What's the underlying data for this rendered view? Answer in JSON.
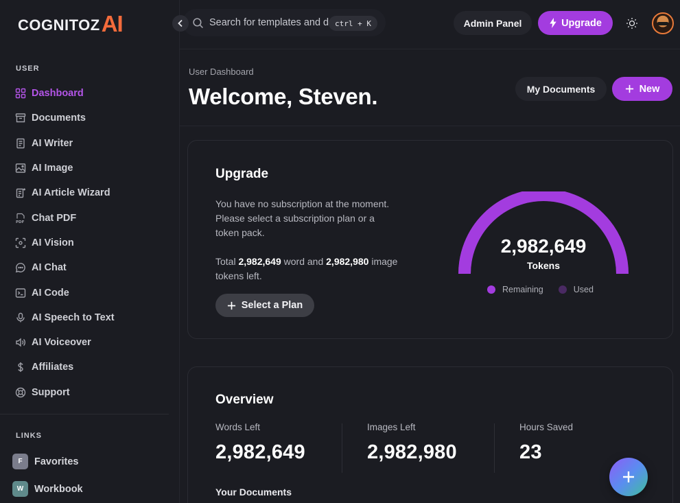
{
  "brand": {
    "word": "COGNITOZ",
    "ai": "AI"
  },
  "search": {
    "placeholder": "Search for templates and documents...",
    "shortcut": "ctrl + K"
  },
  "topbar": {
    "admin_label": "Admin Panel",
    "upgrade_label": "Upgrade"
  },
  "sidebar": {
    "section_user": "USER",
    "items": [
      {
        "label": "Dashboard",
        "icon": "grid-icon"
      },
      {
        "label": "Documents",
        "icon": "archive-icon"
      },
      {
        "label": "AI Writer",
        "icon": "file-text-icon"
      },
      {
        "label": "AI Image",
        "icon": "image-icon"
      },
      {
        "label": "AI Article Wizard",
        "icon": "wizard-icon"
      },
      {
        "label": "Chat PDF",
        "icon": "pdf-icon"
      },
      {
        "label": "AI Vision",
        "icon": "vision-icon"
      },
      {
        "label": "AI Chat",
        "icon": "chat-icon"
      },
      {
        "label": "AI Code",
        "icon": "terminal-icon"
      },
      {
        "label": "AI Speech to Text",
        "icon": "microphone-icon"
      },
      {
        "label": "AI Voiceover",
        "icon": "speaker-icon"
      },
      {
        "label": "Affiliates",
        "icon": "dollar-icon"
      },
      {
        "label": "Support",
        "icon": "lifebuoy-icon"
      }
    ],
    "section_links": "LINKS",
    "links": [
      {
        "badge": "F",
        "label": "Favorites",
        "color": "#7b7d8c"
      },
      {
        "badge": "W",
        "label": "Workbook",
        "color": "#5f8a8b"
      }
    ]
  },
  "header": {
    "breadcrumb": "User Dashboard",
    "title": "Welcome, Steven.",
    "docs_label": "My Documents",
    "new_label": "New"
  },
  "upgrade_card": {
    "title": "Upgrade",
    "message": "You have no subscription at the moment. Please select a subscription plan or a token pack.",
    "tokens_prefix": "Total",
    "word_tokens": "2,982,649",
    "tokens_middle": "word and",
    "image_tokens": "2,982,980",
    "tokens_suffix": "image tokens left.",
    "plan_button": "Select a Plan",
    "gauge_value": "2,982,649",
    "gauge_unit": "Tokens",
    "gauge_remaining_fraction": 1.0,
    "legend_remaining": "Remaining",
    "legend_used": "Used"
  },
  "overview": {
    "title": "Overview",
    "stats": [
      {
        "label": "Words Left",
        "value": "2,982,649"
      },
      {
        "label": "Images Left",
        "value": "2,982,980"
      },
      {
        "label": "Hours Saved",
        "value": "23"
      }
    ],
    "documents_heading": "Your Documents"
  },
  "colors": {
    "accent": "#a33cdf",
    "active_nav": "#b455e8",
    "remaining": "#a33cdf",
    "used": "#4a2a63",
    "logo_ai": "#f36b3b"
  }
}
